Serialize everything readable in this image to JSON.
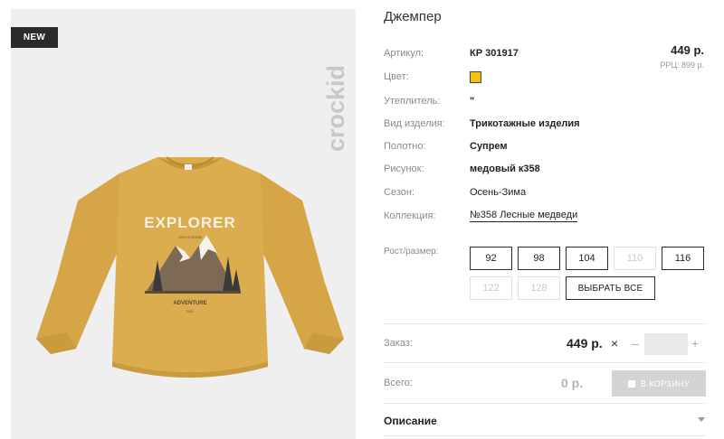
{
  "image": {
    "badge": "NEW",
    "brand_logo": "crockid",
    "print_main": "EXPLORER",
    "print_tagline": "LIFE IS GOOD",
    "print_bottom": "ADVENTURE",
    "print_small": "2021"
  },
  "product": {
    "title": "Джемпер",
    "price": "449 р.",
    "rrp": "РРЦ: 899 р."
  },
  "specs": [
    {
      "label": "Артикул:",
      "value": "КР 301917"
    },
    {
      "label": "Цвет:",
      "value": ""
    },
    {
      "label": "Утеплитель:",
      "value": "\""
    },
    {
      "label": "Вид изделия:",
      "value": "Трикотажные изделия"
    },
    {
      "label": "Полотно:",
      "value": "Супрем"
    },
    {
      "label": "Рисунок:",
      "value": "медовый к358"
    },
    {
      "label": "Сезон:",
      "value": "Осень-Зима"
    },
    {
      "label": "Коллекция:",
      "value": "№358 Лесные медведи"
    }
  ],
  "colors": {
    "swatch": "#f2c20c",
    "sweater": "#d9a94a",
    "cart_button": "#d4d4d4"
  },
  "sizes": {
    "label": "Рост/размер:",
    "options": [
      {
        "value": "92",
        "available": true
      },
      {
        "value": "98",
        "available": true
      },
      {
        "value": "104",
        "available": true
      },
      {
        "value": "110",
        "available": false
      },
      {
        "value": "116",
        "available": true
      },
      {
        "value": "122",
        "available": false
      },
      {
        "value": "128",
        "available": false
      }
    ],
    "select_all": "ВЫБРАТЬ ВСЕ"
  },
  "order": {
    "label": "Заказ:",
    "price": "449 р.",
    "times": "×",
    "minus": "–",
    "quantity": "",
    "plus": "+"
  },
  "total": {
    "label": "Всего:",
    "value": "0 р.",
    "cart_button": "В КОРЗИНУ"
  },
  "description": {
    "label": "Описание"
  }
}
